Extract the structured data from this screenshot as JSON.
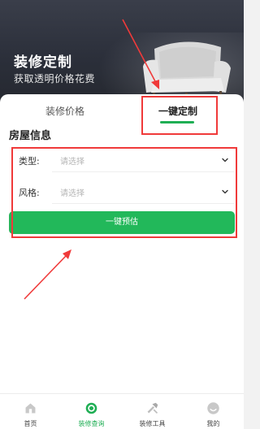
{
  "hero": {
    "title": "装修定制",
    "subtitle": "获取透明价格花费"
  },
  "tabs": [
    {
      "label": "装修价格",
      "active": false
    },
    {
      "label": "一键定制",
      "active": true
    }
  ],
  "form": {
    "section_title": "房屋信息",
    "fields": [
      {
        "label": "类型:",
        "placeholder": "请选择",
        "icon": "chevron-down-icon"
      },
      {
        "label": "风格:",
        "placeholder": "请选择",
        "icon": "chevron-down-icon"
      }
    ],
    "submit_label": "一键预估"
  },
  "bottom_nav": [
    {
      "label": "首页",
      "icon": "home-icon",
      "active": false
    },
    {
      "label": "装修查询",
      "icon": "target-icon",
      "active": true
    },
    {
      "label": "装修工具",
      "icon": "tools-icon",
      "active": false
    },
    {
      "label": "我的",
      "icon": "profile-icon",
      "active": false
    }
  ],
  "colors": {
    "accent": "#22b85a",
    "annotation": "#f03a3a",
    "hero_bg": "#2f333d"
  }
}
